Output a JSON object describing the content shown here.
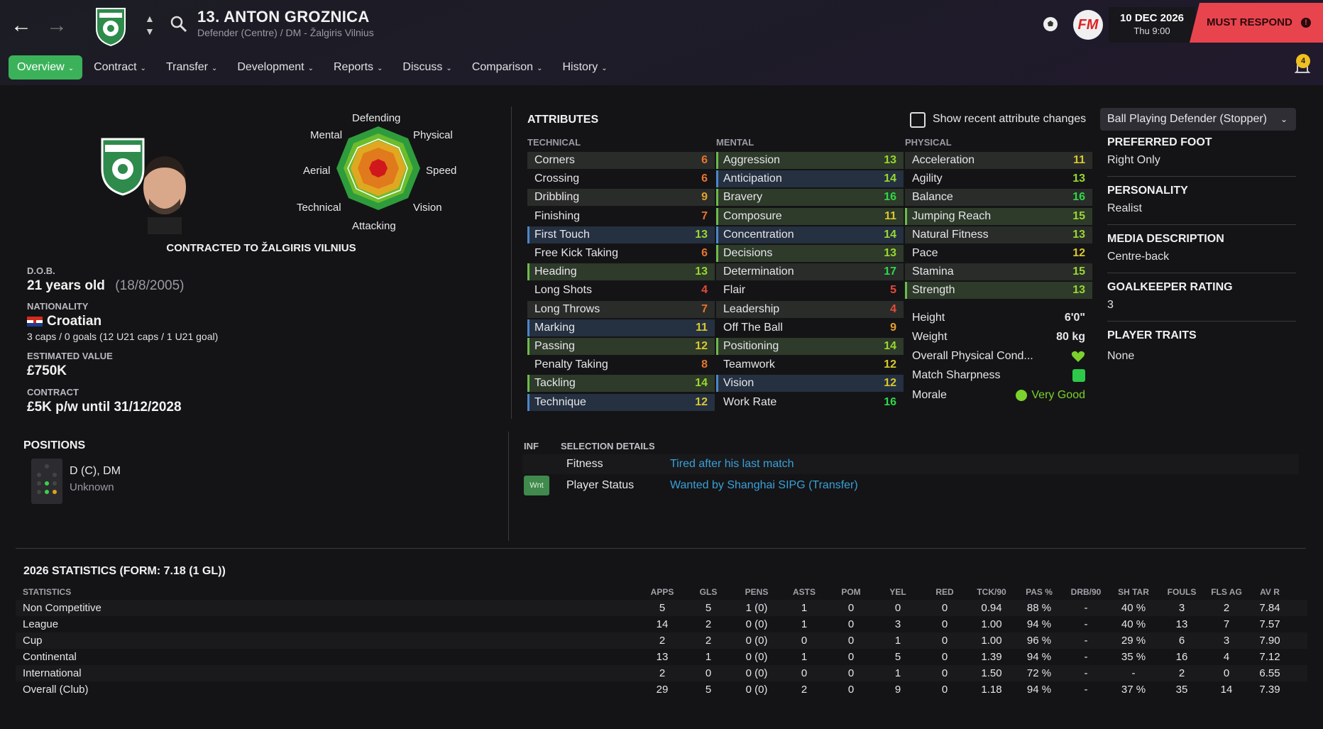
{
  "header": {
    "title": "13. ANTON GROZNICA",
    "subtitle": "Defender (Centre) / DM - Žalgiris Vilnius",
    "date": "10 DEC 2026",
    "time": "Thu 9:00",
    "must_respond": "MUST RESPOND",
    "fm_logo": "FM",
    "notification_count": "4"
  },
  "menu": [
    {
      "label": "Overview",
      "active": true
    },
    {
      "label": "Contract"
    },
    {
      "label": "Transfer"
    },
    {
      "label": "Development"
    },
    {
      "label": "Reports"
    },
    {
      "label": "Discuss"
    },
    {
      "label": "Comparison"
    },
    {
      "label": "History"
    }
  ],
  "radar": {
    "labels": {
      "top": "Defending",
      "tr": "Physical",
      "r": "Speed",
      "br": "Vision",
      "bottom": "Attacking",
      "bl": "Technical",
      "l": "Aerial",
      "tl": "Mental"
    }
  },
  "profile": {
    "contracted": "CONTRACTED TO ŽALGIRIS VILNIUS",
    "dob_label": "D.O.B.",
    "age": "21 years old",
    "dob": "(18/8/2005)",
    "nationality_label": "NATIONALITY",
    "nationality": "Croatian",
    "caps": "3 caps / 0 goals (12 U21 caps / 1 U21 goal)",
    "value_label": "ESTIMATED VALUE",
    "value": "£750K",
    "contract_label": "CONTRACT",
    "contract": "£5K p/w until 31/12/2028"
  },
  "attributes": {
    "title": "ATTRIBUTES",
    "show_changes": "Show recent attribute changes",
    "role": "Ball Playing Defender (Stopper)",
    "technical_head": "TECHNICAL",
    "mental_head": "MENTAL",
    "physical_head": "PHYSICAL",
    "technical": [
      {
        "name": "Corners",
        "value": "6"
      },
      {
        "name": "Crossing",
        "value": "6"
      },
      {
        "name": "Dribbling",
        "value": "9"
      },
      {
        "name": "Finishing",
        "value": "7"
      },
      {
        "name": "First Touch",
        "value": "13"
      },
      {
        "name": "Free Kick Taking",
        "value": "6"
      },
      {
        "name": "Heading",
        "value": "13"
      },
      {
        "name": "Long Shots",
        "value": "4"
      },
      {
        "name": "Long Throws",
        "value": "7"
      },
      {
        "name": "Marking",
        "value": "11"
      },
      {
        "name": "Passing",
        "value": "12"
      },
      {
        "name": "Penalty Taking",
        "value": "8"
      },
      {
        "name": "Tackling",
        "value": "14"
      },
      {
        "name": "Technique",
        "value": "12"
      }
    ],
    "mental": [
      {
        "name": "Aggression",
        "value": "13"
      },
      {
        "name": "Anticipation",
        "value": "14"
      },
      {
        "name": "Bravery",
        "value": "16"
      },
      {
        "name": "Composure",
        "value": "11"
      },
      {
        "name": "Concentration",
        "value": "14"
      },
      {
        "name": "Decisions",
        "value": "13"
      },
      {
        "name": "Determination",
        "value": "17"
      },
      {
        "name": "Flair",
        "value": "5"
      },
      {
        "name": "Leadership",
        "value": "4"
      },
      {
        "name": "Off The Ball",
        "value": "9"
      },
      {
        "name": "Positioning",
        "value": "14"
      },
      {
        "name": "Teamwork",
        "value": "12"
      },
      {
        "name": "Vision",
        "value": "12"
      },
      {
        "name": "Work Rate",
        "value": "16"
      }
    ],
    "physical": [
      {
        "name": "Acceleration",
        "value": "11"
      },
      {
        "name": "Agility",
        "value": "13"
      },
      {
        "name": "Balance",
        "value": "16"
      },
      {
        "name": "Jumping Reach",
        "value": "15"
      },
      {
        "name": "Natural Fitness",
        "value": "13"
      },
      {
        "name": "Pace",
        "value": "12"
      },
      {
        "name": "Stamina",
        "value": "15"
      },
      {
        "name": "Strength",
        "value": "13"
      }
    ],
    "height_label": "Height",
    "height": "6'0\"",
    "weight_label": "Weight",
    "weight": "80 kg",
    "condition_label": "Overall Physical Cond...",
    "sharpness_label": "Match Sharpness",
    "morale_label": "Morale",
    "morale": "Very Good"
  },
  "info": {
    "foot_label": "PREFERRED FOOT",
    "foot": "Right Only",
    "personality_label": "PERSONALITY",
    "personality": "Realist",
    "media_label": "MEDIA DESCRIPTION",
    "media": "Centre-back",
    "gk_label": "GOALKEEPER RATING",
    "gk": "3",
    "traits_label": "PLAYER TRAITS",
    "traits": "None"
  },
  "positions": {
    "title": "POSITIONS",
    "pos": "D (C), DM",
    "sub": "Unknown"
  },
  "selection": {
    "inf": "INF",
    "title": "SELECTION DETAILS",
    "fitness_label": "Fitness",
    "fitness": "Tired after his last match",
    "wnt": "Wnt",
    "status_label": "Player Status",
    "status": "Wanted by Shanghai SIPG (Transfer)"
  },
  "stats": {
    "title": "2026 STATISTICS (FORM: 7.18 (1 GL))",
    "headers": [
      "STATISTICS",
      "APPS",
      "GLS",
      "PENS",
      "ASTS",
      "POM",
      "YEL",
      "RED",
      "TCK/90",
      "PAS %",
      "DRB/90",
      "SH TAR",
      "FOULS",
      "FLS AG",
      "AV R"
    ],
    "rows": [
      [
        "Non Competitive",
        "5",
        "5",
        "1 (0)",
        "1",
        "0",
        "0",
        "0",
        "0.94",
        "88 %",
        "-",
        "40 %",
        "3",
        "2",
        "7.84"
      ],
      [
        "League",
        "14",
        "2",
        "0 (0)",
        "1",
        "0",
        "3",
        "0",
        "1.00",
        "94 %",
        "-",
        "40 %",
        "13",
        "7",
        "7.57"
      ],
      [
        "Cup",
        "2",
        "2",
        "0 (0)",
        "0",
        "0",
        "1",
        "0",
        "1.00",
        "96 %",
        "-",
        "29 %",
        "6",
        "3",
        "7.90"
      ],
      [
        "Continental",
        "13",
        "1",
        "0 (0)",
        "1",
        "0",
        "5",
        "0",
        "1.39",
        "94 %",
        "-",
        "35 %",
        "16",
        "4",
        "7.12"
      ],
      [
        "International",
        "2",
        "0",
        "0 (0)",
        "0",
        "0",
        "1",
        "0",
        "1.50",
        "72 %",
        "-",
        "-",
        "2",
        "0",
        "6.55"
      ],
      [
        "Overall (Club)",
        "29",
        "5",
        "0 (0)",
        "2",
        "0",
        "9",
        "0",
        "1.18",
        "94 %",
        "-",
        "37 %",
        "35",
        "14",
        "7.39"
      ]
    ]
  }
}
